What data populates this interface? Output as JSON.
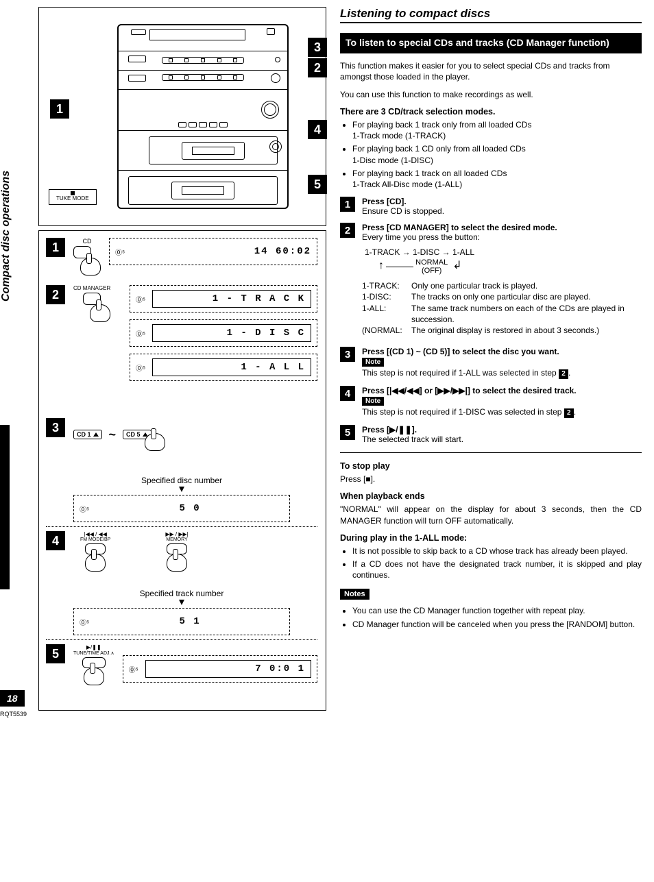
{
  "sideTab": "Compact disc operations",
  "pageNumber": "18",
  "docId": "RQT5539",
  "device": {
    "tukeLabel": "TUKE MODE",
    "callouts": {
      "c1": "1",
      "c2": "2",
      "c3": "3",
      "c4": "4",
      "c5": "5"
    }
  },
  "leftSteps": {
    "s1": {
      "num": "1",
      "btn": "CD",
      "lcd": "14  60:02"
    },
    "s2": {
      "num": "2",
      "btn": "CD MANAGER",
      "lcdA": "1 - T R A C K",
      "lcdB": "1 -  D I S C",
      "lcdC": "1 - A L L"
    },
    "s3": {
      "num": "3",
      "cd1": "CD 1",
      "cd5": "CD 5",
      "tilde": "~",
      "caption": "Specified disc number",
      "lcd": "5        0"
    },
    "s4": {
      "num": "4",
      "leftBtnTop": "|◀◀ / ◀◀",
      "leftBtnBot": "FM MODE/BP",
      "rightBtnTop": "▶▶ / ▶▶|",
      "rightBtnBot": "MEMORY",
      "caption": "Specified track number",
      "lcd": "5        1"
    },
    "s5": {
      "num": "5",
      "btnTop": "▶/❚❚",
      "btnBot": "TUNE/TIME ADJ.∧",
      "lcd": "7    0:0 1"
    }
  },
  "right": {
    "sectionTitle": "Listening to compact discs",
    "blackHead": "To listen to special CDs and tracks (CD Manager function)",
    "intro1": "This function makes it easier for you to select special CDs and tracks from amongst those loaded in the player.",
    "intro2": "You can use this function to make recordings as well.",
    "modesHead": "There are 3 CD/track selection modes.",
    "modes": [
      "For playing back 1 track only from all loaded CDs\n1-Track mode (1-TRACK)",
      "For playing back 1 CD only from all loaded CDs\n1-Disc mode (1-DISC)",
      "For playing back 1 track on all loaded CDs\n1-Track All-Disc mode (1-ALL)"
    ],
    "step1": {
      "n": "1",
      "t": "Press [CD].",
      "b": "Ensure CD is stopped."
    },
    "step2": {
      "n": "2",
      "t": "Press [CD MANAGER] to select the desired mode.",
      "b": "Every time you press the button:",
      "flow": "1-TRACK → 1-DISC → 1-ALL",
      "normal": "NORMAL\n(OFF)",
      "table": [
        [
          "1-TRACK:",
          "Only one particular track is played."
        ],
        [
          "1-DISC:",
          "The tracks on only one particular disc are played."
        ],
        [
          "1-ALL:",
          "The same track numbers on each of the CDs are played in succession."
        ],
        [
          "(NORMAL:",
          "The original display is restored in about 3 seconds.)"
        ]
      ]
    },
    "step3": {
      "n": "3",
      "t": "Press [(CD 1) ~ (CD 5)] to select the disc you want.",
      "note": "Note",
      "b": "This step is not required if 1-ALL was selected in step",
      "ref": "2"
    },
    "step4": {
      "n": "4",
      "t": "Press [|◀◀/◀◀] or [▶▶/▶▶|] to select the desired track.",
      "note": "Note",
      "b": "This step is not required if 1-DISC was selected in step",
      "ref": "2"
    },
    "step5": {
      "n": "5",
      "t": "Press [▶/❚❚].",
      "b": "The selected track will start."
    },
    "stopHead": "To stop play",
    "stopBody": "Press [■].",
    "endHead": "When playback ends",
    "endBody": "\"NORMAL\" will appear on the display for about 3 seconds, then the CD MANAGER function will turn OFF automatically.",
    "duringHead": "During play in the 1-ALL mode:",
    "duringList": [
      "It is not possible to skip back to a CD whose track has already been played.",
      "If a CD does not have the designated track number, it is skipped and play continues."
    ],
    "notesHead": "Notes",
    "notesList": [
      "You can use the CD Manager function together with repeat play.",
      "CD Manager function will be canceled when you press the [RANDOM] button."
    ]
  }
}
